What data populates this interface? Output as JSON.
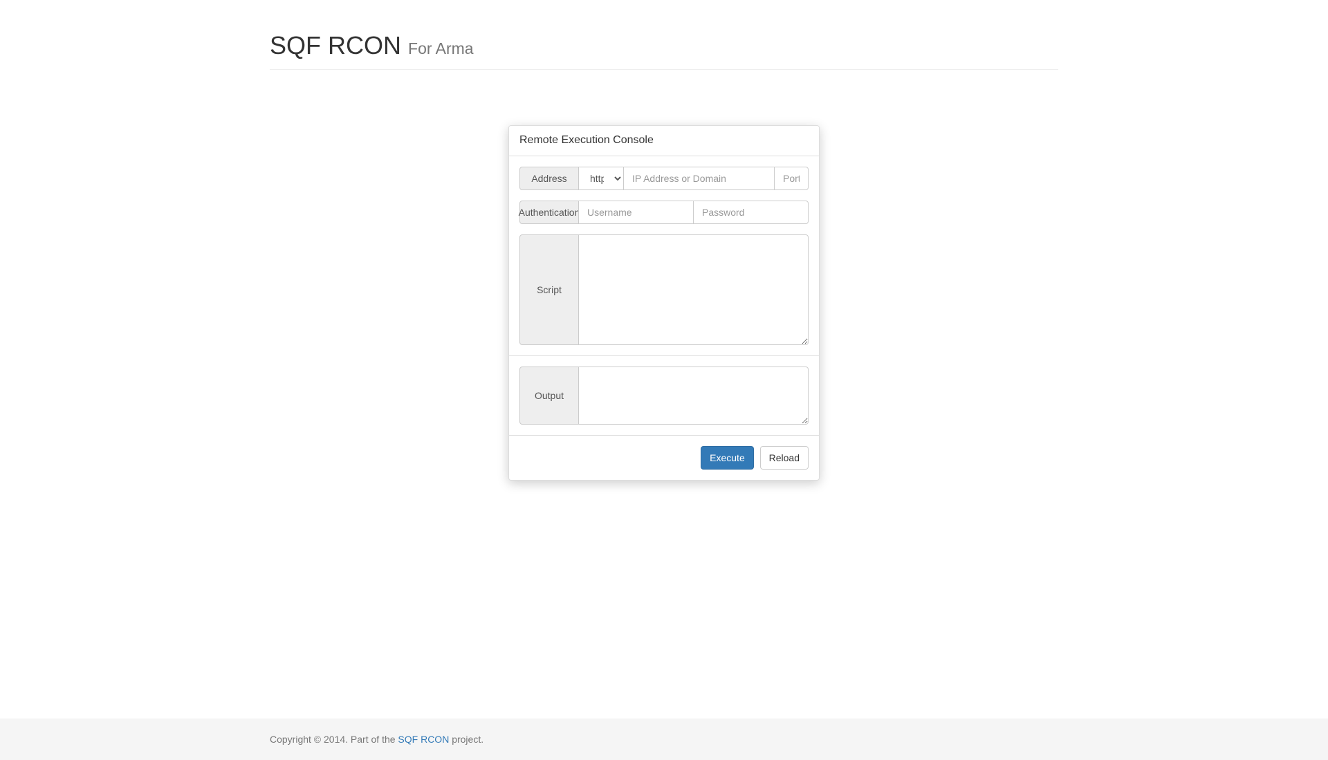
{
  "header": {
    "title": "SQF RCON",
    "subtitle": "For Arma"
  },
  "panel": {
    "title": "Remote Execution Console",
    "address": {
      "label": "Address",
      "protocol_selected": "http://",
      "ip_placeholder": "IP Address or Domain",
      "port_placeholder": "Port"
    },
    "auth": {
      "label": "Authentication",
      "username_placeholder": "Username",
      "password_placeholder": "Password"
    },
    "script": {
      "label": "Script"
    },
    "output": {
      "label": "Output"
    },
    "buttons": {
      "execute": "Execute",
      "reload": "Reload"
    }
  },
  "footer": {
    "copyright_prefix": "Copyright © 2014. Part of the ",
    "link_text": "SQF RCON",
    "copyright_suffix": " project."
  }
}
